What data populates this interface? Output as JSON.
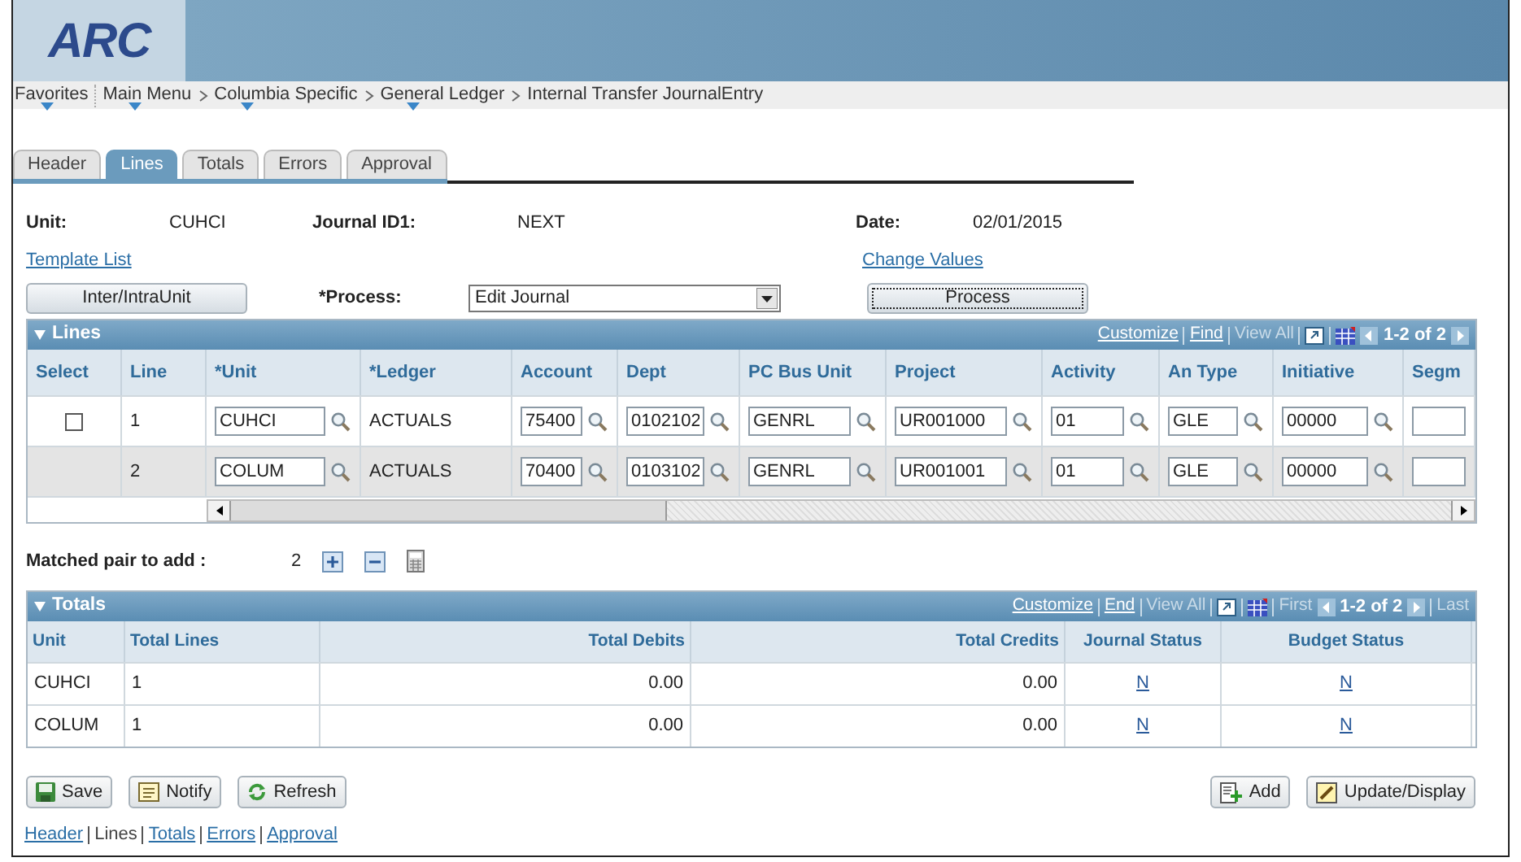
{
  "logo": {
    "text": "ARC"
  },
  "breadcrumb": [
    {
      "label": "Favorites",
      "has_menu": true
    },
    {
      "label": "Main Menu",
      "has_menu": true
    },
    {
      "label": "Columbia Specific",
      "has_menu": true
    },
    {
      "label": "General Ledger",
      "has_menu": true
    },
    {
      "label": "Internal Transfer JournalEntry",
      "has_menu": false
    }
  ],
  "tabs": [
    {
      "label": "Header",
      "selected": false
    },
    {
      "label": "Lines",
      "selected": true
    },
    {
      "label": "Totals",
      "selected": false
    },
    {
      "label": "Errors",
      "selected": false
    },
    {
      "label": "Approval",
      "selected": false
    }
  ],
  "header_fields": {
    "unit_label": "Unit:",
    "unit": "CUHCI",
    "journal_label": "Journal ID1:",
    "journal": "NEXT",
    "date_label": "Date:",
    "date": "02/01/2015",
    "template_link": "Template List",
    "change_link": "Change Values"
  },
  "actions": {
    "interunit_button": "Inter/IntraUnit",
    "process_label": "*Process:",
    "process_value": "Edit Journal",
    "process_button": "Process"
  },
  "lines": {
    "title": "Lines",
    "expanded": true,
    "nav": [
      {
        "kind": "link",
        "label": "Customize"
      },
      {
        "kind": "link",
        "label": "Find"
      },
      {
        "kind": "disabled",
        "label": "View All"
      },
      {
        "kind": "zoom"
      },
      {
        "kind": "grid"
      },
      {
        "kind": "prev"
      },
      {
        "kind": "count",
        "label": "1-2 of 2"
      },
      {
        "kind": "next"
      }
    ],
    "columns": [
      "Select",
      "Line",
      "*Unit",
      "*Ledger",
      "Account",
      "Dept",
      "PC Bus Unit",
      "Project",
      "Activity",
      "An Type",
      "Initiative",
      "Segm"
    ],
    "rows": [
      {
        "shaded": false,
        "cells": [
          {
            "kind": "checkbox",
            "checked": false
          },
          {
            "kind": "text",
            "value": "1"
          },
          {
            "kind": "input",
            "value": "CUHCI"
          },
          {
            "kind": "text",
            "value": "ACTUALS"
          },
          {
            "kind": "input",
            "value": "75400"
          },
          {
            "kind": "input",
            "value": "0102102"
          },
          {
            "kind": "input",
            "value": "GENRL"
          },
          {
            "kind": "input",
            "value": "UR001000"
          },
          {
            "kind": "input",
            "value": "01"
          },
          {
            "kind": "input",
            "value": "GLE"
          },
          {
            "kind": "input",
            "value": "00000"
          },
          {
            "kind": "blank_input"
          }
        ]
      },
      {
        "shaded": true,
        "cells": [
          {
            "kind": "none"
          },
          {
            "kind": "text",
            "value": "2"
          },
          {
            "kind": "input",
            "value": "COLUM"
          },
          {
            "kind": "text",
            "value": "ACTUALS"
          },
          {
            "kind": "input",
            "value": "70400"
          },
          {
            "kind": "input",
            "value": "0103102"
          },
          {
            "kind": "input",
            "value": "GENRL"
          },
          {
            "kind": "input",
            "value": "UR001001"
          },
          {
            "kind": "input",
            "value": "01"
          },
          {
            "kind": "input",
            "value": "GLE"
          },
          {
            "kind": "input",
            "value": "00000"
          },
          {
            "kind": "blank_input"
          }
        ]
      }
    ]
  },
  "matched": {
    "label": "Matched pair to add :",
    "value": "2"
  },
  "totals": {
    "title": "Totals",
    "expanded": true,
    "nav": [
      {
        "kind": "link",
        "label": "Customize"
      },
      {
        "kind": "link",
        "label": "End"
      },
      {
        "kind": "disabled",
        "label": "View All"
      },
      {
        "kind": "zoom"
      },
      {
        "kind": "grid"
      },
      {
        "kind": "disabled",
        "label": "First"
      },
      {
        "kind": "prev"
      },
      {
        "kind": "count",
        "label": "1-2 of 2"
      },
      {
        "kind": "next"
      },
      {
        "kind": "disabled",
        "label": "Last"
      }
    ],
    "columns": [
      "Unit",
      "Total Lines",
      "Total Debits",
      "Total Credits",
      "Journal Status",
      "Budget Status"
    ],
    "rows": [
      [
        "CUHCI",
        "1",
        "0.00",
        "0.00",
        "N",
        "N"
      ],
      [
        "COLUM",
        "1",
        "0.00",
        "0.00",
        "N",
        "N"
      ]
    ]
  },
  "buttons_left": [
    {
      "kind": "save",
      "label": "Save"
    },
    {
      "kind": "notify",
      "label": "Notify"
    },
    {
      "kind": "refresh",
      "label": "Refresh"
    }
  ],
  "buttons_right": [
    {
      "kind": "add",
      "label": "Add"
    },
    {
      "kind": "update",
      "label": "Update/Display"
    }
  ],
  "footer_links": [
    {
      "label": "Header",
      "link": true
    },
    {
      "label": "Lines",
      "link": false
    },
    {
      "label": "Totals",
      "link": true
    },
    {
      "label": "Errors",
      "link": true
    },
    {
      "label": "Approval",
      "link": true
    }
  ]
}
